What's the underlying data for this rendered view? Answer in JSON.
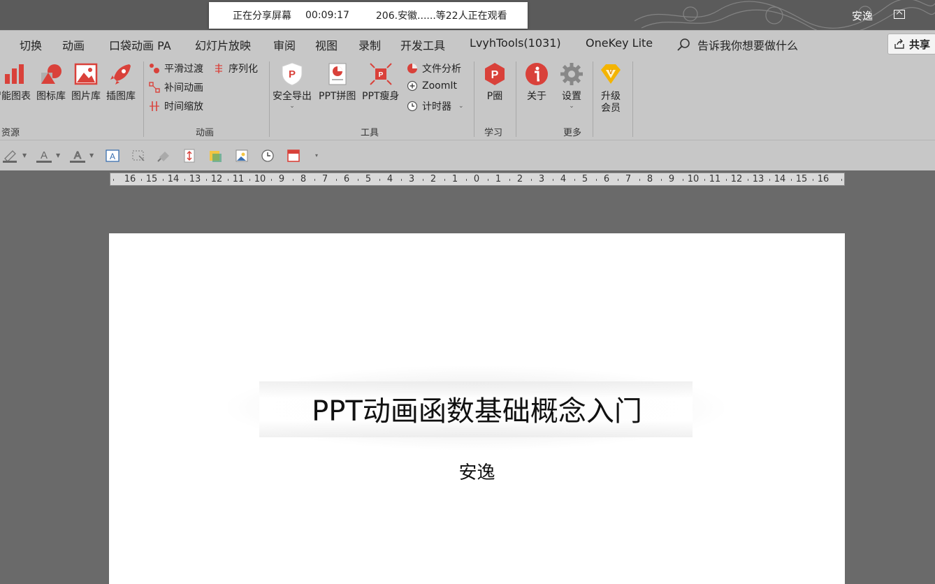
{
  "titlebar": {
    "user": "安逸"
  },
  "share_overlay": {
    "status": "正在分享屏幕",
    "timer": "00:09:17",
    "viewers": "206.安徽......等22人正在观看"
  },
  "tabs": [
    {
      "label": "切换"
    },
    {
      "label": "动画"
    },
    {
      "label": "口袋动画 PA"
    },
    {
      "label": "幻灯片放映"
    },
    {
      "label": "审阅"
    },
    {
      "label": "视图"
    },
    {
      "label": "录制"
    },
    {
      "label": "开发工具"
    },
    {
      "label": "LvyhTools(1031)"
    },
    {
      "label": "OneKey Lite"
    }
  ],
  "tell_me": "告诉我你想要做什么",
  "share_button": "共享",
  "ribbon": {
    "resources": {
      "label": "资源",
      "buttons": [
        "智能图表",
        "图标库",
        "图片库",
        "插图库"
      ]
    },
    "animation": {
      "label": "动画",
      "items": [
        "平滑过渡",
        "补间动画",
        "时间缩放",
        "序列化"
      ]
    },
    "tools": {
      "label": "工具",
      "buttons": [
        "安全导出",
        "PPT拼图",
        "PPT瘦身"
      ],
      "items": [
        "文件分析",
        "ZoomIt",
        "计时器"
      ]
    },
    "learn": {
      "label": "学习",
      "buttons": [
        "P圈"
      ]
    },
    "more": {
      "label": "更多",
      "buttons": [
        "关于",
        "设置"
      ],
      "upgrade": [
        "升级",
        "会员"
      ]
    }
  },
  "ruler": [
    "16",
    "15",
    "14",
    "13",
    "12",
    "11",
    "10",
    "9",
    "8",
    "7",
    "6",
    "5",
    "4",
    "3",
    "2",
    "1",
    "0",
    "1",
    "2",
    "3",
    "4",
    "5",
    "6",
    "7",
    "8",
    "9",
    "10",
    "11",
    "12",
    "13",
    "14",
    "15",
    "16"
  ],
  "slide": {
    "title": "PPT动画函数基础概念入门",
    "subtitle": "安逸"
  },
  "colors": {
    "accent_red": "#d9413a",
    "gold": "#f4b400"
  }
}
